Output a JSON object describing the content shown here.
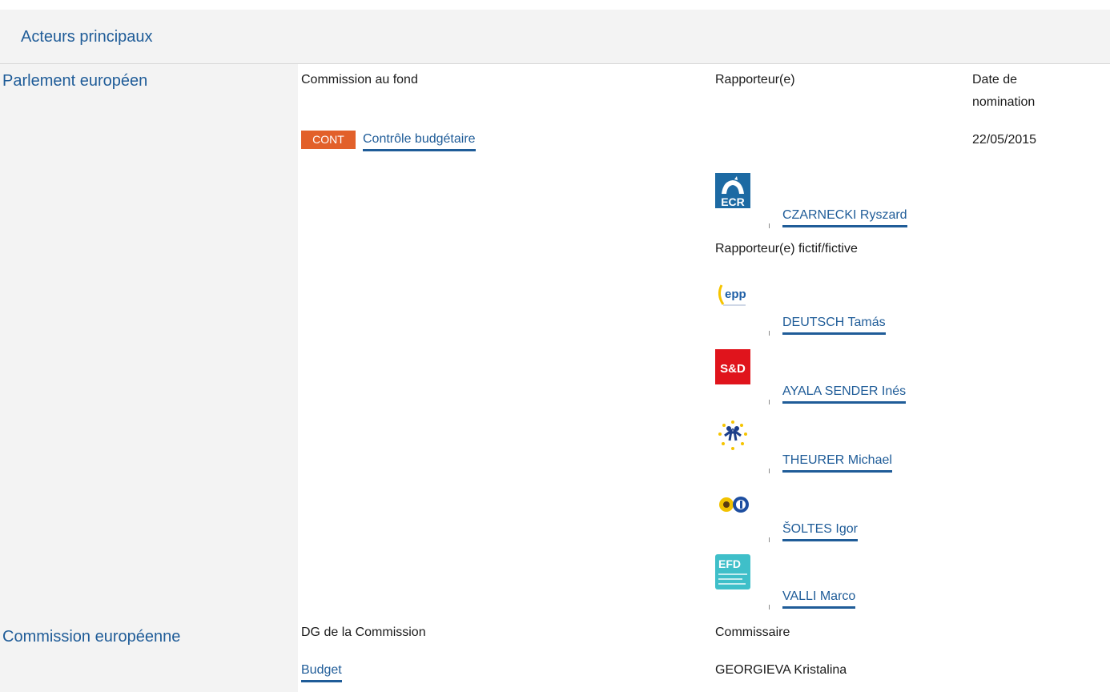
{
  "header": {
    "title": "Acteurs principaux"
  },
  "parliament": {
    "title": "Parlement européen",
    "col_committee": "Commission au fond",
    "col_rapporteur": "Rapporteur(e)",
    "col_date_line1": "Date de",
    "col_date_line2": "nomination",
    "committee_badge": "CONT",
    "committee_name": "Contrôle budgétaire",
    "date": "22/05/2015",
    "rapporteur": {
      "name": "CZARNECKI Ryszard",
      "group_logo": "ECR"
    },
    "shadow_label": "Rapporteur(e) fictif/fictive",
    "shadows": [
      {
        "name": "DEUTSCH Tamás",
        "group_logo": "epp"
      },
      {
        "name": "AYALA SENDER Inés",
        "group_logo": "S&D"
      },
      {
        "name": "THEURER Michael",
        "group_logo": "alde-icon"
      },
      {
        "name": "ŠOLTES Igor",
        "group_logo": "greens-efa-icon"
      },
      {
        "name": "VALLI Marco",
        "group_logo": "EFD"
      }
    ]
  },
  "commission": {
    "title": "Commission européenne",
    "col_dg": "DG de la Commission",
    "col_commissioner": "Commissaire",
    "dg": "Budget",
    "commissioner": "GEORGIEVA Kristalina"
  },
  "colors": {
    "link": "#1f5c98",
    "badge": "#e2602a",
    "panel": "#f3f3f3"
  }
}
